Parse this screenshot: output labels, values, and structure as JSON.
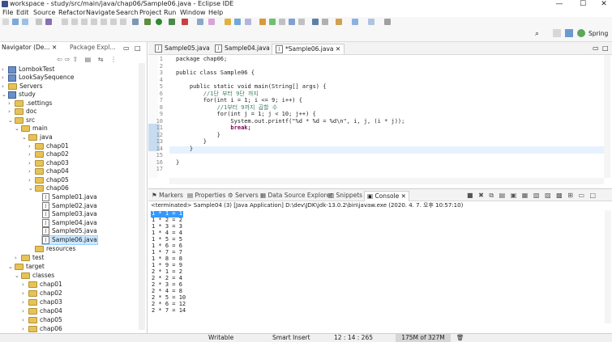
{
  "window": {
    "title": "workspace - study/src/main/java/chap06/Sample06.java - Eclipse IDE",
    "minimize": "—",
    "maximize": "☐",
    "close": "✕"
  },
  "menu": [
    "File",
    "Edit",
    "Source",
    "Refactor",
    "Navigate",
    "Search",
    "Project",
    "Run",
    "Window",
    "Help"
  ],
  "perspective": {
    "label": "Spring"
  },
  "navigator": {
    "tab1": "Navigator (De...",
    "tab2": "Package Expl...",
    "items": [
      "LombokTest",
      "LookSaySequence",
      "Servers",
      "study",
      ".settings",
      "doc",
      "src",
      "main",
      "java",
      "chap01",
      "chap02",
      "chap03",
      "chap04",
      "chap05",
      "chap06",
      "Sample01.java",
      "Sample02.java",
      "Sample03.java",
      "Sample04.java",
      "Sample05.java",
      "Sample06.java",
      "resources",
      "test",
      "target",
      "classes",
      "chap01",
      "chap02",
      "chap03",
      "chap04",
      "chap05",
      "chap06"
    ]
  },
  "editor": {
    "tabs": [
      "Sample05.java",
      "Sample04.java",
      "*Sample06.java"
    ],
    "line_numbers": [
      "1",
      "2",
      "3",
      "4",
      "5",
      "6",
      "7",
      "8",
      "9",
      "10",
      "11",
      "12",
      "13",
      "14",
      "15",
      "16",
      "17"
    ],
    "lines": [
      "package chap06;",
      "",
      "public class Sample06 {",
      "",
      "    public static void main(String[] args) {",
      "        //1단 부터 9단 까지",
      "        for(int i = 1; i <= 9; i++) {",
      "            //1부터 9까지 곱할 수",
      "            for(int j = 1; j < 10; j++) {",
      "                System.out.printf(\"%d * %d = %d\\n\", i, j, (i * j));",
      "                break;",
      "            }",
      "        }",
      "    }",
      "",
      "}",
      ""
    ]
  },
  "console": {
    "tabs": [
      "Markers",
      "Properties",
      "Servers",
      "Data Source Explorer",
      "Snippets",
      "Console"
    ],
    "header": "<terminated> Sample04 (3) [Java Application] D:\\dev\\JDK\\jdk-13.0.2\\bin\\javaw.exe (2020. 4. 7. 오후 10:57:10)",
    "lines": [
      "1 * 1 = 1",
      "1 * 2 = 2",
      "1 * 3 = 3",
      "1 * 4 = 4",
      "1 * 5 = 5",
      "1 * 6 = 6",
      "1 * 7 = 7",
      "1 * 8 = 8",
      "1 * 9 = 9",
      "2 * 1 = 2",
      "2 * 2 = 4",
      "2 * 3 = 6",
      "2 * 4 = 8",
      "2 * 5 = 10",
      "2 * 6 = 12",
      "2 * 7 = 14"
    ]
  },
  "status": {
    "writable": "Writable",
    "insert": "Smart Insert",
    "position": "12 : 14 : 265",
    "memory": "175M of 327M"
  }
}
